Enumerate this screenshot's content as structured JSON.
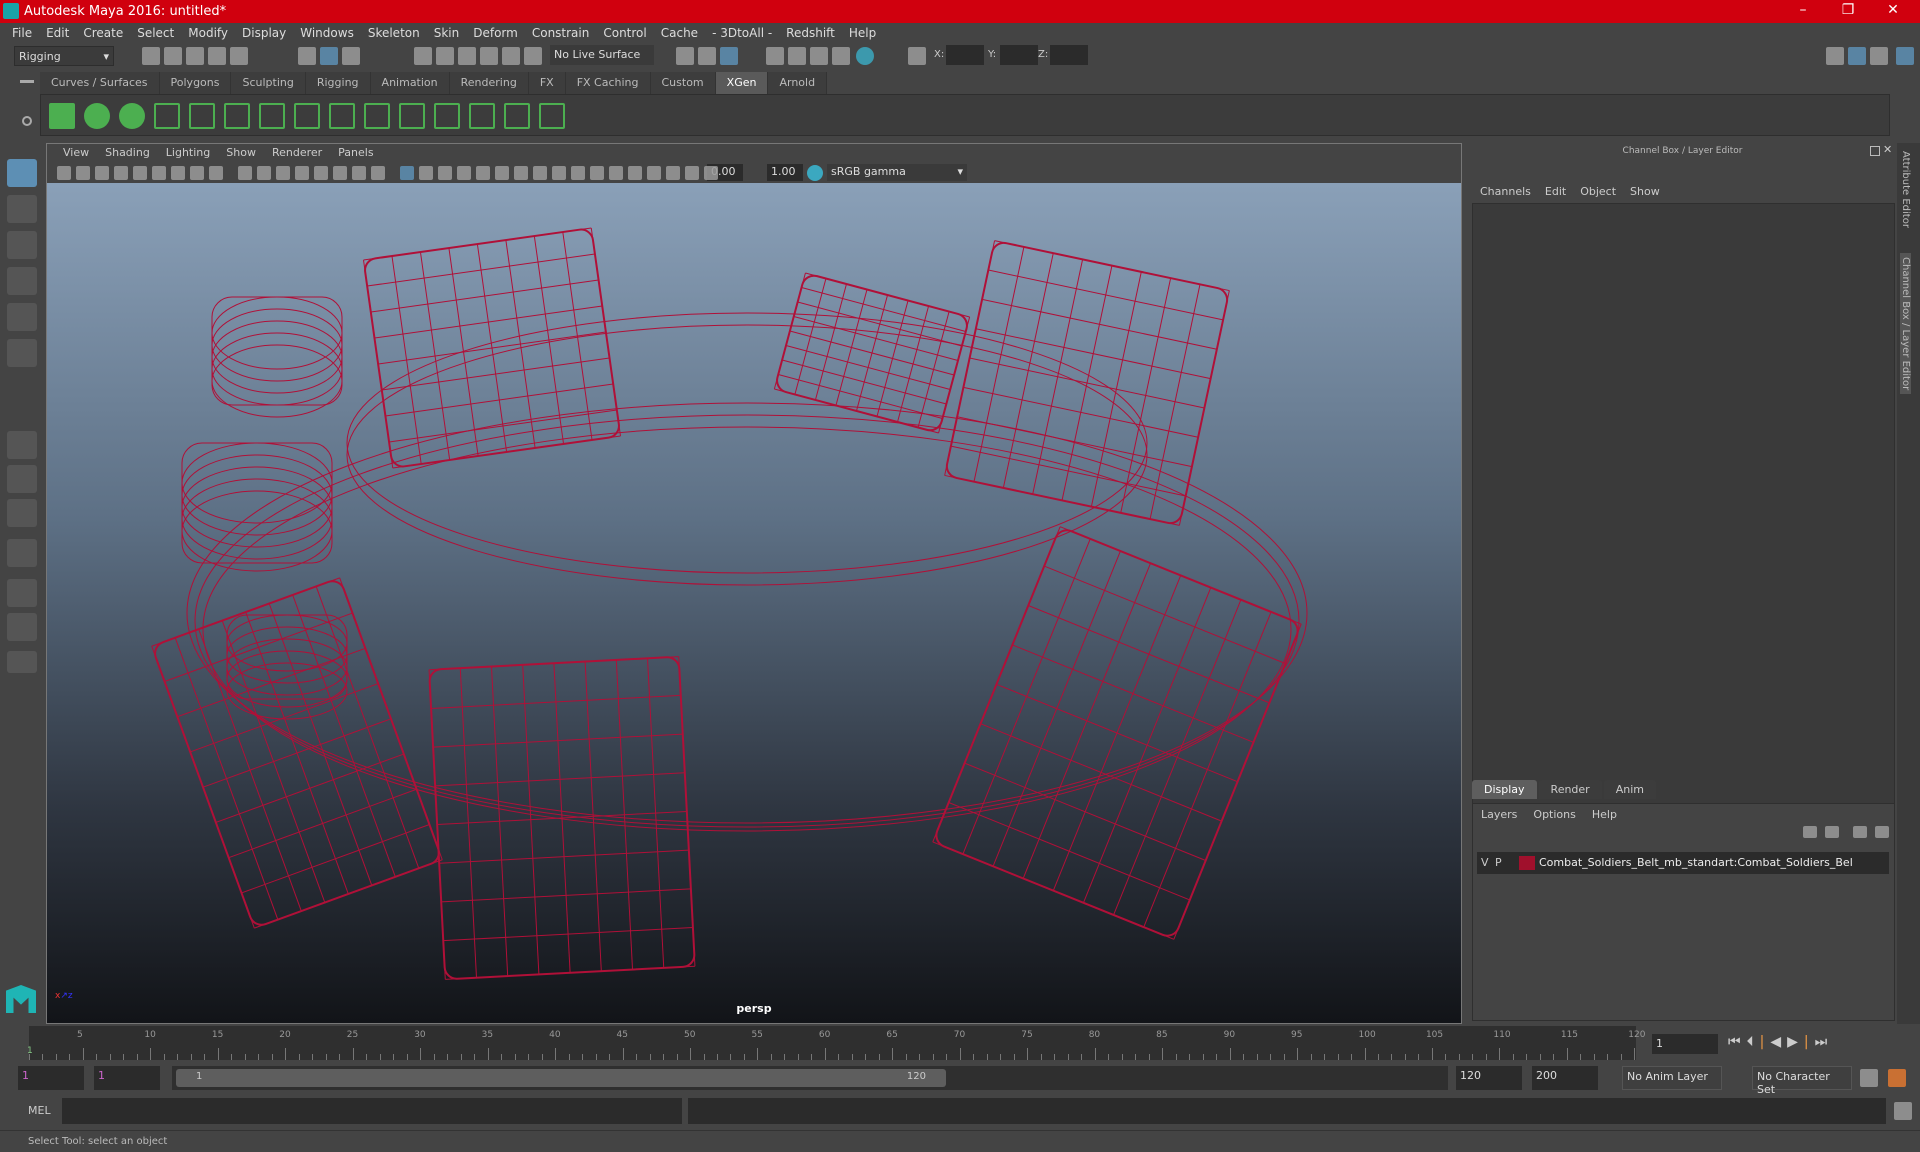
{
  "title": "Autodesk Maya 2016: untitled*",
  "window_buttons": [
    "–",
    "❐",
    "✕"
  ],
  "menus": [
    "File",
    "Edit",
    "Create",
    "Select",
    "Modify",
    "Display",
    "Windows",
    "Skeleton",
    "Skin",
    "Deform",
    "Constrain",
    "Control",
    "Cache",
    "- 3DtoAll -",
    "Redshift",
    "Help"
  ],
  "status": {
    "mode": "Rigging",
    "live_surface": "No Live Surface",
    "x_label": "X:",
    "y_label": "Y:",
    "z_label": "Z:"
  },
  "shelf_tabs": [
    "Curves / Surfaces",
    "Polygons",
    "Sculpting",
    "Rigging",
    "Animation",
    "Rendering",
    "FX",
    "FX Caching",
    "Custom",
    "XGen",
    "Arnold"
  ],
  "active_shelf": "XGen",
  "viewport": {
    "menus": [
      "View",
      "Shading",
      "Lighting",
      "Show",
      "Renderer",
      "Panels"
    ],
    "exposure": "0.00",
    "gamma": "1.00",
    "color_space": "sRGB gamma",
    "camera": "persp",
    "wire_color": "#b01038"
  },
  "channel_box": {
    "title": "Channel Box / Layer Editor",
    "menus": [
      "Channels",
      "Edit",
      "Object",
      "Show"
    ]
  },
  "layer_editor": {
    "tabs": [
      "Display",
      "Render",
      "Anim"
    ],
    "active_tab": "Display",
    "menus": [
      "Layers",
      "Options",
      "Help"
    ],
    "layers": [
      {
        "v": "V",
        "p": "P",
        "color": "#a0102c",
        "name": "Combat_Soldiers_Belt_mb_standart:Combat_Soldiers_Bel"
      }
    ]
  },
  "side_tabs": [
    "Attribute Editor",
    "Channel Box / Layer Editor"
  ],
  "timeline": {
    "labels": [
      5,
      10,
      15,
      20,
      25,
      30,
      35,
      40,
      45,
      50,
      55,
      60,
      65,
      70,
      75,
      80,
      85,
      90,
      95,
      100,
      105,
      110,
      115,
      120
    ],
    "start_marker": "1",
    "current_frame": "1"
  },
  "range": {
    "start": "1",
    "playback_start": "1",
    "slider_start": "1",
    "slider_end": "120",
    "playback_end": "120",
    "end": "200",
    "anim_layer": "No Anim Layer",
    "character_set": "No Character Set"
  },
  "command": {
    "label": "MEL"
  },
  "help_line": "Select Tool: select an object"
}
